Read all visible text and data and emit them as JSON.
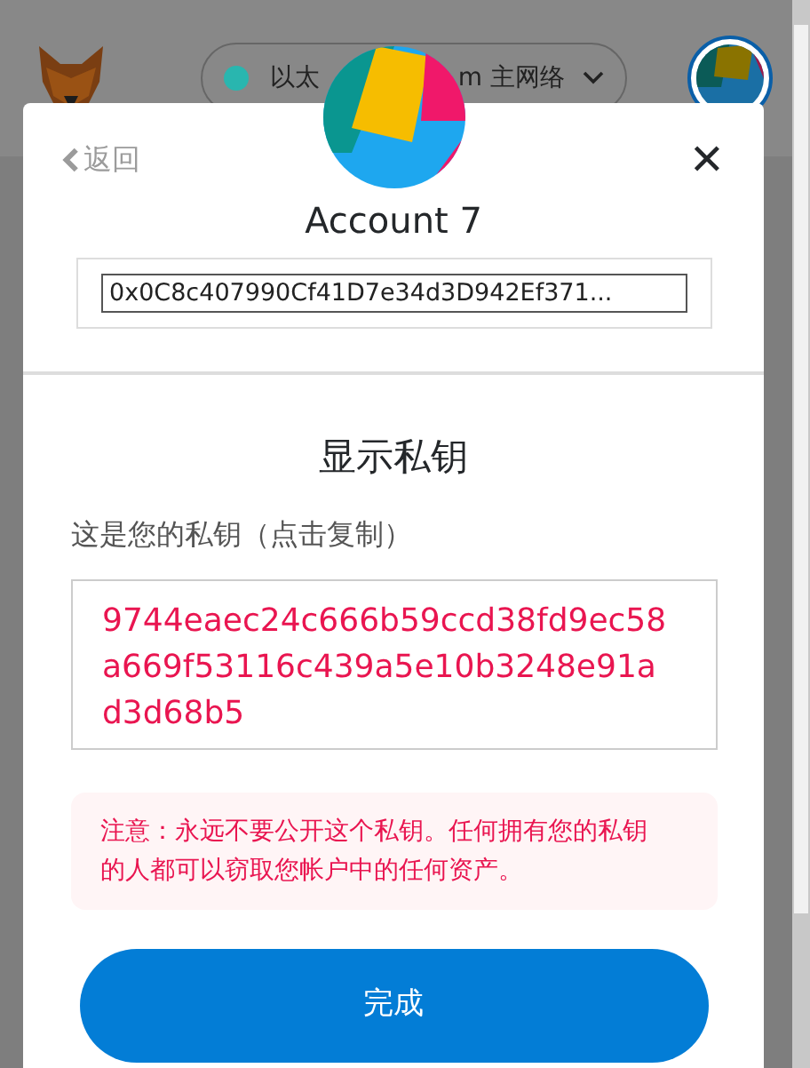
{
  "header": {
    "network_label_start": "以太",
    "network_label_end": "m 主网络"
  },
  "modal": {
    "back_label": "返回",
    "close_symbol": "✕",
    "account_name": "Account 7",
    "address": "0x0C8c407990Cf41D7e34d3D942Ef371...",
    "section_title": "显示私钥",
    "key_label": "这是您的私钥（点击复制）",
    "private_key": "9744eaec24c666b59ccd38fd9ec58a669f53116c439a5e10b3248e91ad3d68b5",
    "warning": "注意：永远不要公开这个私钥。任何拥有您的私钥的人都可以窃取您帐户中的任何资产。",
    "done_button": "完成"
  }
}
